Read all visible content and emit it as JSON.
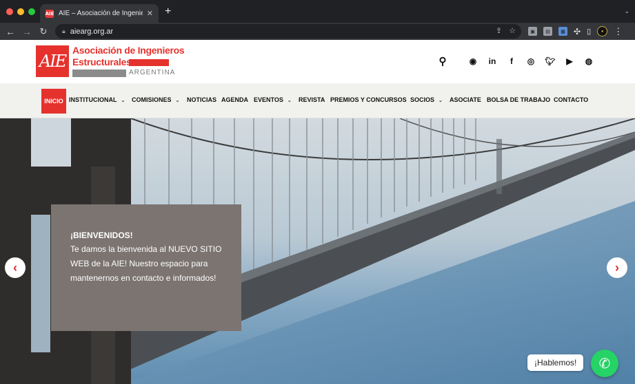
{
  "browser": {
    "tab_title": "AIE – Asociación de Ingenieros",
    "tab_favicon_text": "AIE",
    "url": "aiearg.org.ar",
    "traffic_light_colors": [
      "#ff5f57",
      "#febc2e",
      "#28c840"
    ]
  },
  "header": {
    "logo_text": "AIE",
    "org_line1": "Asociación de Ingenieros",
    "org_line2": "Estructurales",
    "org_country": "ARGENTINA",
    "social_icons": [
      "search-icon",
      "whatsapp-icon",
      "linkedin-icon",
      "facebook-icon",
      "instagram-icon",
      "twitter-icon",
      "youtube-icon",
      "issuu-icon"
    ]
  },
  "nav": {
    "items": [
      {
        "label": "INICIO",
        "active": true
      },
      {
        "label": "INSTITUCIONAL",
        "dropdown": true
      },
      {
        "label": "COMISIONES",
        "dropdown": true
      },
      {
        "label": "NOTICIAS"
      },
      {
        "label": "AGENDA"
      },
      {
        "label": "EVENTOS",
        "dropdown": true
      },
      {
        "label": "REVISTA"
      },
      {
        "label": "PREMIOS Y CONCURSOS"
      },
      {
        "label": "SOCIOS",
        "dropdown": true
      },
      {
        "label": "ASOCIATE"
      },
      {
        "label": "BOLSA DE TRABAJO"
      },
      {
        "label": "CONTACTO"
      }
    ],
    "accent_color": "#e5322d"
  },
  "hero": {
    "welcome_title": "¡BIENVENIDOS!",
    "welcome_body": "Te damos la bienvenida al NUEVO SITIO WEB de la AIE! Nuestro espacio para mantenernos en contacto e informados!",
    "prev_arrow": "‹",
    "next_arrow": "›"
  },
  "chat": {
    "label": "¡Hablemos!"
  }
}
